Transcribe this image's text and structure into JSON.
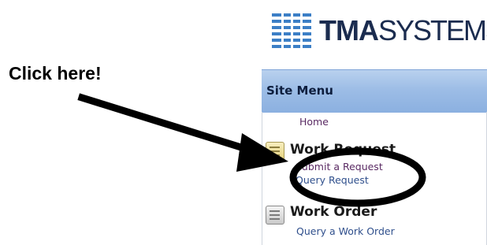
{
  "logo": {
    "bold_text": "TMA",
    "light_text": "SYSTEMS",
    "icon": "grid-logo-icon",
    "color": "#1b2c4f",
    "icon_color": "#3c7fc6"
  },
  "callout": {
    "text": "Click here!"
  },
  "menu": {
    "title": "Site Menu",
    "home_label": "Home",
    "sections": [
      {
        "title": "Work Request",
        "icon": "document-icon",
        "links": [
          "Submit a Request",
          "Query Request"
        ]
      },
      {
        "title": "Work Order",
        "icon": "document-icon",
        "links": [
          "Query a Work Order"
        ]
      }
    ]
  },
  "annotations": {
    "arrow": "arrow-icon",
    "highlight": "circle-highlight",
    "color": "#000000"
  }
}
